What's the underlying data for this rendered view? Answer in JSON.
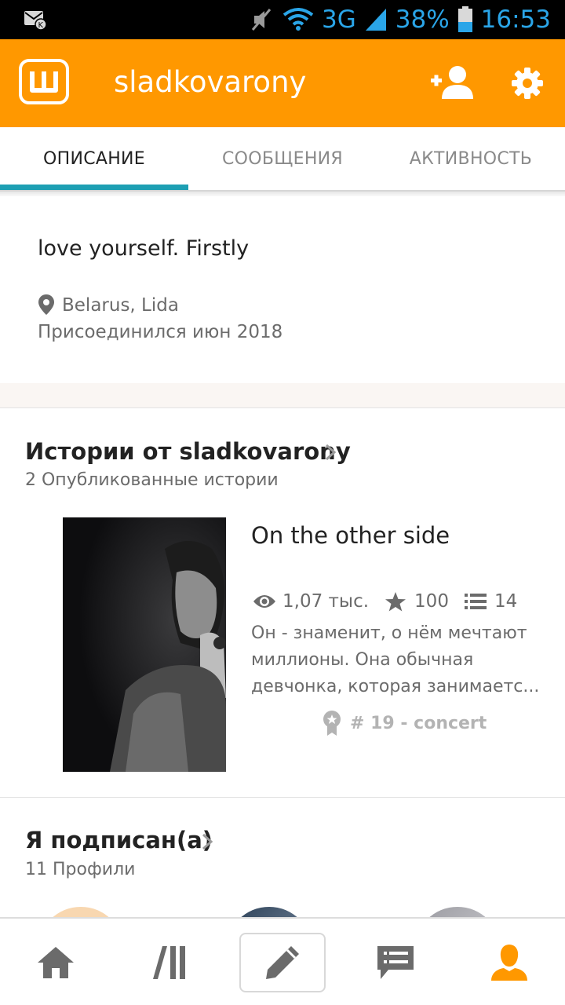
{
  "status_bar": {
    "network": "3G",
    "battery": "38%",
    "time": "16:53"
  },
  "app_bar": {
    "logo_letter": "ш",
    "username": "sladkovarony"
  },
  "tabs": [
    {
      "label": "ОПИСАНИЕ",
      "active": true
    },
    {
      "label": "СООБЩЕНИЯ",
      "active": false
    },
    {
      "label": "АКТИВНОСТЬ",
      "active": false
    }
  ],
  "profile": {
    "about": "love yourself. Firstly",
    "location": "Belarus, Lida",
    "joined": "Присоединился июн 2018"
  },
  "stories": {
    "title": "Истории от sladkovarony",
    "subtitle": "2 Опубликованные истории",
    "items": [
      {
        "title": "On the other side",
        "views": "1,07 тыс.",
        "votes": "100",
        "parts": "14",
        "description_lines": [
          "Он - знаменит, о нём мечтают",
          "миллионы. Она обычная",
          "девчонка, которая занимаетс..."
        ],
        "tag": "# 19 - concert"
      }
    ]
  },
  "following": {
    "title": "Я подписан(а)",
    "subtitle": "11 Профили"
  },
  "colors": {
    "accent": "#ff9800",
    "tab_indicator": "#1d9fb3",
    "statusbar_icons": "#2aa5e8"
  },
  "icons": {
    "logo": "wattpad-logo",
    "add_user": "add-user-icon",
    "settings": "gear-icon",
    "location": "map-pin-icon",
    "views": "eye-icon",
    "votes": "star-icon",
    "parts": "list-icon",
    "tag": "ribbon-badge-icon",
    "nav": [
      "home-icon",
      "library-icon",
      "pencil-icon",
      "messages-icon",
      "profile-icon"
    ]
  }
}
